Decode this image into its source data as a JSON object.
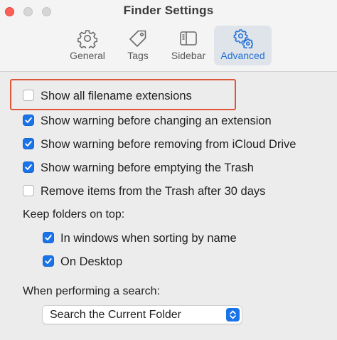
{
  "window": {
    "title": "Finder Settings"
  },
  "tabs": [
    {
      "label": "General",
      "icon": "gear-icon",
      "selected": false
    },
    {
      "label": "Tags",
      "icon": "tag-icon",
      "selected": false
    },
    {
      "label": "Sidebar",
      "icon": "sidebar-icon",
      "selected": false
    },
    {
      "label": "Advanced",
      "icon": "gears-icon",
      "selected": true
    }
  ],
  "options": [
    {
      "label": "Show all filename extensions",
      "checked": false
    },
    {
      "label": "Show warning before changing an extension",
      "checked": true
    },
    {
      "label": "Show warning before removing from iCloud Drive",
      "checked": true
    },
    {
      "label": "Show warning before emptying the Trash",
      "checked": true
    },
    {
      "label": "Remove items from the Trash after 30 days",
      "checked": false
    }
  ],
  "folders_on_top": {
    "heading": "Keep folders on top:",
    "options": [
      {
        "label": "In windows when sorting by name",
        "checked": true
      },
      {
        "label": "On Desktop",
        "checked": true
      }
    ]
  },
  "search": {
    "heading": "When performing a search:",
    "selected": "Search the Current Folder"
  },
  "colors": {
    "accent": "#1a73e8",
    "highlight_box": "#e0553a",
    "close_button": "#ff5f57"
  }
}
